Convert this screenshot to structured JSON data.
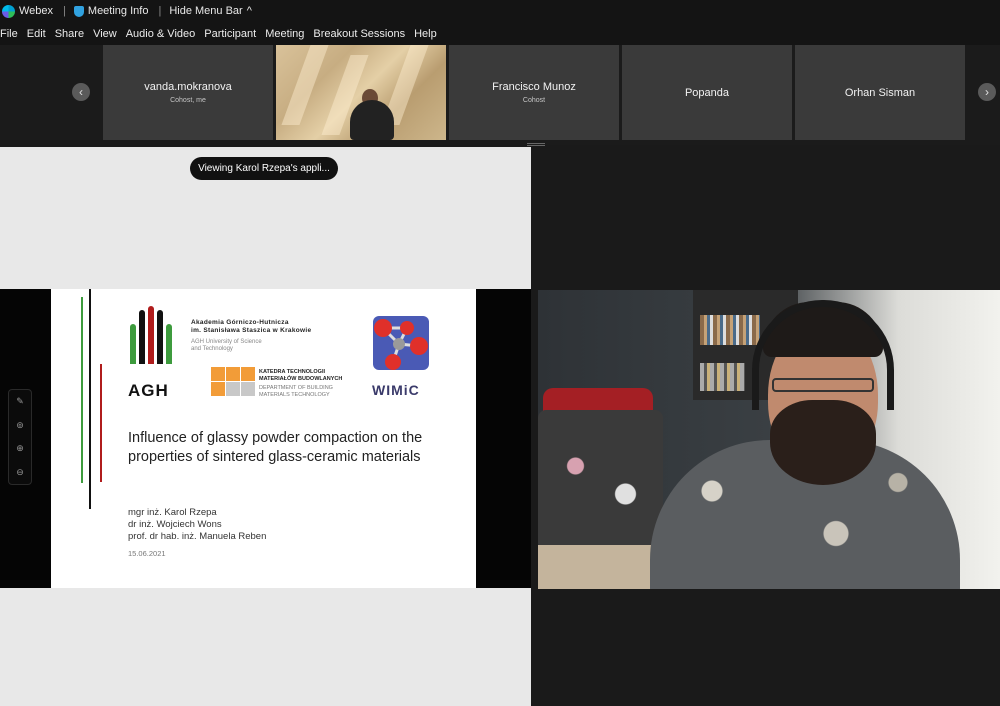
{
  "titlebar": {
    "app_name": "Webex",
    "meeting_info": "Meeting Info",
    "hide_menu": "Hide Menu Bar",
    "chevron": "^"
  },
  "menu": [
    "File",
    "Edit",
    "Share",
    "View",
    "Audio & Video",
    "Participant",
    "Meeting",
    "Breakout Sessions",
    "Help"
  ],
  "participants": [
    {
      "name": "vanda.mokranova",
      "role": "Cohost, me"
    },
    {
      "name": "",
      "role": ""
    },
    {
      "name": "Francisco Munoz",
      "role": "Cohost"
    },
    {
      "name": "Popanda",
      "role": ""
    },
    {
      "name": "Orhan Sisman",
      "role": ""
    }
  ],
  "nav": {
    "prev": "‹",
    "next": "›"
  },
  "share": {
    "viewing_label": "Viewing Karol Rzepa's appli..."
  },
  "slide": {
    "agh_logo_text": "AGH",
    "university": {
      "line1": "Akademia Górniczo-Hutnicza",
      "line2": "im. Stanisława Staszica w Krakowie",
      "line3": "AGH University of Science",
      "line4": "and Technology"
    },
    "department": {
      "line1": "KATEDRA TECHNOLOGII",
      "line2": "MATERIAŁÓW BUDOWLANYCH",
      "line3": "DEPARTMENT OF BUILDING",
      "line4": "MATERIALS TECHNOLOGY"
    },
    "wimic_text": "WIMiC",
    "title": "Influence of glassy powder compaction on the properties of sintered glass-ceramic materials",
    "authors": [
      "mgr inż. Karol Rzepa",
      "dr inż. Wojciech Wons",
      "prof. dr hab. inż. Manuela  Reben"
    ],
    "date": "15.06.2021"
  },
  "colors": {
    "agh_green": "#3d9b3d",
    "agh_red": "#b01c1c",
    "kat_orange": "#f29c38",
    "wimic_red": "#e0302a"
  }
}
